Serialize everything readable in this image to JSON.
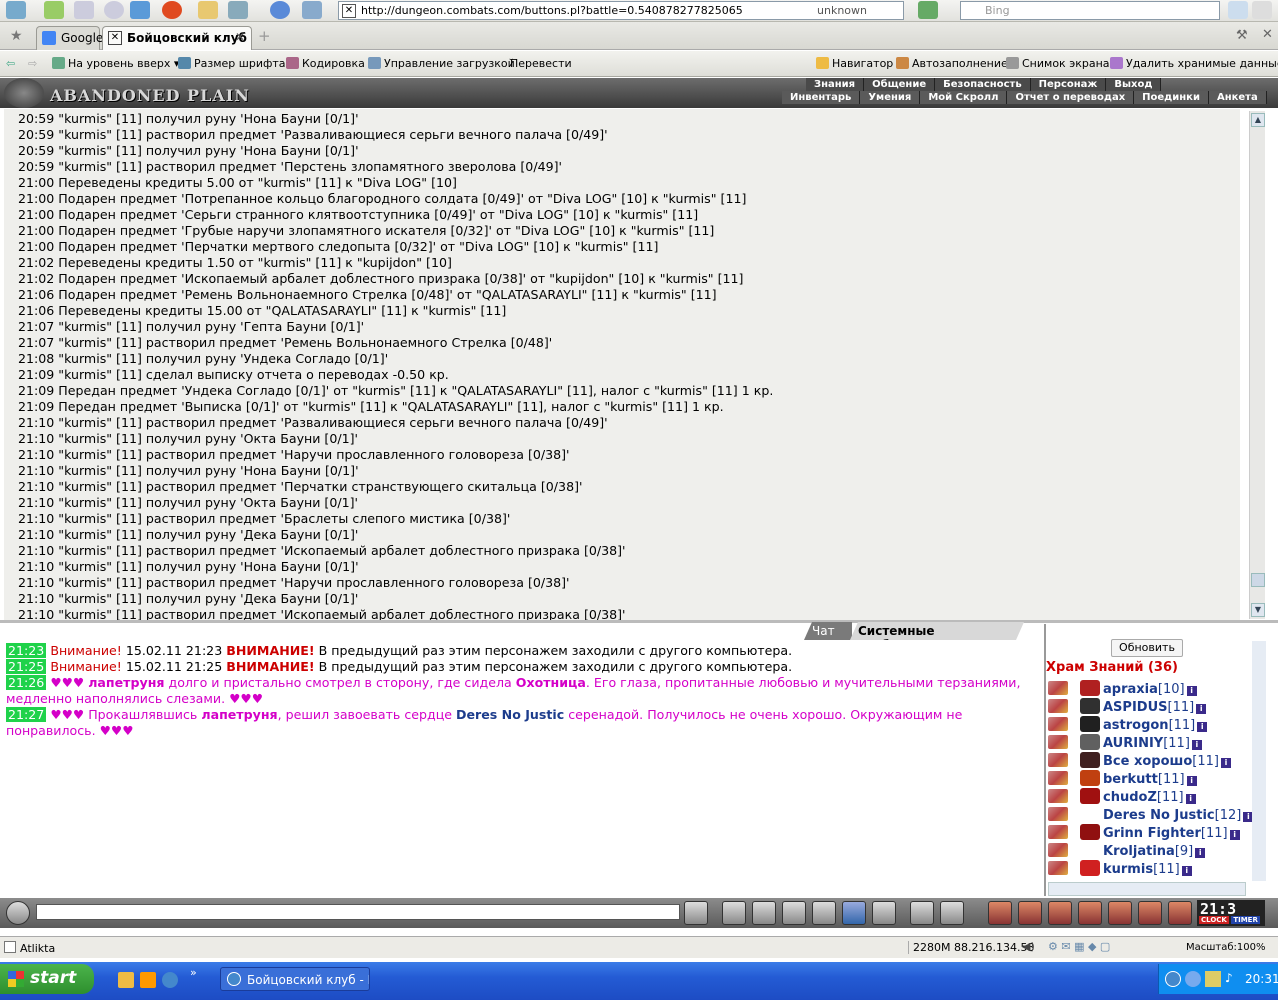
{
  "browser": {
    "url": "http://dungeon.combats.com/buttons.pl?battle=0.540878277825065",
    "security_label": "unknown",
    "search_placeholder": "Bing",
    "tabs": [
      {
        "label": "Google"
      },
      {
        "label": "Бойцовский клуб"
      }
    ],
    "toolbar": {
      "up": "На уровень вверх",
      "font_size": "Размер шрифта",
      "encoding": "Кодировка",
      "downloads": "Управление загрузкой",
      "translate": "Перевести",
      "navigator": "Навигатор",
      "autofill": "Автозаполнение",
      "screenshot": "Снимок экрана",
      "delete_data": "Удалить хранимые данные..."
    }
  },
  "game": {
    "logo": "ABANDONED PLAIN",
    "menu_row1": [
      "Знания",
      "Общение",
      "Безопасность",
      "Персонаж",
      "Выход"
    ],
    "menu_row2": [
      "Инвентарь",
      "Умения",
      "Мой Скролл",
      "Отчет о переводах",
      "Поединки",
      "Анкета"
    ],
    "log_lines": [
      "20:59 \"kurmis\" [11] получил руну 'Нона Бауни [0/1]'",
      "20:59 \"kurmis\" [11] растворил предмет 'Разваливающиеся серьги вечного палача [0/49]'",
      "20:59 \"kurmis\" [11] получил руну 'Нона Бауни [0/1]'",
      "20:59 \"kurmis\" [11] растворил предмет 'Перстень злопамятного зверолова [0/49]'",
      "21:00 Переведены кредиты 5.00 от \"kurmis\" [11] к \"Diva LOG\" [10]",
      "21:00 Подарен предмет 'Потрепанное кольцо благородного солдата [0/49]' от \"Diva LOG\" [10] к \"kurmis\" [11]",
      "21:00 Подарен предмет 'Серьги странного клятвоотступника [0/49]' от \"Diva LOG\" [10] к \"kurmis\" [11]",
      "21:00 Подарен предмет 'Грубые наручи злопамятного искателя [0/32]' от \"Diva LOG\" [10] к \"kurmis\" [11]",
      "21:00 Подарен предмет 'Перчатки мертвого следопыта [0/32]' от \"Diva LOG\" [10] к \"kurmis\" [11]",
      "21:02 Переведены кредиты 1.50 от \"kurmis\" [11] к \"kupijdon\" [10]",
      "21:02 Подарен предмет 'Ископаемый арбалет доблестного призрака [0/38]' от \"kupijdon\" [10] к \"kurmis\" [11]",
      "21:06 Подарен предмет 'Ремень Вольнонаемного Стрелка [0/48]' от \"QALATASARAYLI\" [11] к \"kurmis\" [11]",
      "21:06 Переведены кредиты 15.00 от \"QALATASARAYLI\" [11] к \"kurmis\" [11]",
      "21:07 \"kurmis\" [11] получил руну 'Гепта Бауни [0/1]'",
      "21:07 \"kurmis\" [11] растворил предмет 'Ремень Вольнонаемного Стрелка [0/48]'",
      "21:08 \"kurmis\" [11] получил руну 'Ундека Согладо [0/1]'",
      "21:09 \"kurmis\" [11] сделал выписку отчета о переводах -0.50 кр.",
      "21:09 Передан предмет 'Ундека Согладо [0/1]' от \"kurmis\" [11] к \"QALATASARAYLI\" [11], налог с \"kurmis\" [11] 1 кр.",
      "21:09 Передан предмет 'Выписка [0/1]' от \"kurmis\" [11] к \"QALATASARAYLI\" [11], налог с \"kurmis\" [11] 1 кр.",
      "21:10 \"kurmis\" [11] растворил предмет 'Разваливающиеся серьги вечного палача [0/49]'",
      "21:10 \"kurmis\" [11] получил руну 'Окта Бауни [0/1]'",
      "21:10 \"kurmis\" [11] растворил предмет 'Наручи прославленного головореза [0/38]'",
      "21:10 \"kurmis\" [11] получил руну 'Нона Бауни [0/1]'",
      "21:10 \"kurmis\" [11] растворил предмет 'Перчатки странствующего скитальца [0/38]'",
      "21:10 \"kurmis\" [11] получил руну 'Окта Бауни [0/1]'",
      "21:10 \"kurmis\" [11] растворил предмет 'Браслеты слепого мистика [0/38]'",
      "21:10 \"kurmis\" [11] получил руну 'Дека Бауни [0/1]'",
      "21:10 \"kurmis\" [11] растворил предмет 'Ископаемый арбалет доблестного призрака [0/38]'",
      "21:10 \"kurmis\" [11] получил руну 'Нона Бауни [0/1]'",
      "21:10 \"kurmis\" [11] растворил предмет 'Наручи прославленного головореза [0/38]'",
      "21:10 \"kurmis\" [11] получил руну 'Дека Бауни [0/1]'",
      "21:10 \"kurmis\" [11] растворил предмет 'Ископаемый арбалет доблестного призрака [0/38]'"
    ],
    "chat_tabs": {
      "chat": "Чат",
      "system": "Системные сообщения"
    },
    "chat": {
      "l1": {
        "time": "21:23",
        "w1": "Внимание!",
        "date": "15.02.11 21:23",
        "w2": "ВНИМАНИЕ!",
        "msg": "В предыдущий раз этим персонажем заходили с другого компьютера."
      },
      "l2": {
        "time": "21:25",
        "w1": "Внимание!",
        "date": "15.02.11 21:25",
        "w2": "ВНИМАНИЕ!",
        "msg": "В предыдущий раз этим персонажем заходили с другого компьютера."
      },
      "l3": {
        "time": "21:26",
        "hearts": "♥♥♥",
        "name": "лапетруня",
        "p1": "долго и пристально смотрел в сторону, где сидела",
        "target": "Охотница",
        "p2": ". Его глаза, пропитанные любовью и мучительными терзаниями, медленно наполнялись слезами.",
        "end": "♥♥♥"
      },
      "l4": {
        "time": "21:27",
        "hearts": "♥♥♥",
        "p0": "Прокашлявшись",
        "name": "лапетруня",
        "p1": ", решил завоевать сердце",
        "target": "Deres No Justic",
        "p2": "серенадой. Получилось не очень хорошо. Окружающим не понравилось.",
        "end": "♥♥♥"
      }
    },
    "refresh_label": "Обновить",
    "room": "Храм Знаний (36)",
    "users": [
      {
        "name": "apraxia",
        "level": "[10]",
        "align_color": "#b02020"
      },
      {
        "name": "ASPIDUS",
        "level": "[11]",
        "align_color": "#303030"
      },
      {
        "name": "astrogon",
        "level": "[11]",
        "align_color": "#202020"
      },
      {
        "name": "AURINIY",
        "level": "[11]",
        "align_color": "#606060"
      },
      {
        "name": "Все хорошо",
        "level": "[11]",
        "align_color": "#402020"
      },
      {
        "name": "berkutt",
        "level": "[11]",
        "align_color": "#c04010"
      },
      {
        "name": "chudoZ",
        "level": "[11]",
        "align_color": "#a01010"
      },
      {
        "name": "Deres No Justic",
        "level": "[12]",
        "align_color": "#ffffff"
      },
      {
        "name": "Grinn Fighter",
        "level": "[11]",
        "align_color": "#901010"
      },
      {
        "name": "Kroljatina",
        "level": "[9]",
        "align_color": "#ffffff"
      },
      {
        "name": "kurmis",
        "level": "[11]",
        "align_color": "#d02020"
      }
    ],
    "clock": "21:3",
    "clock_label": "CLOCK",
    "timer_label": "TIMER"
  },
  "statusbar": {
    "left": "Atlikta",
    "memory_ip": "2280M 88.216.134.53",
    "zoom": "Масштаб:100%"
  },
  "taskbar": {
    "start": "start",
    "window": "Бойцовский клуб - M...",
    "time": "20:31"
  }
}
